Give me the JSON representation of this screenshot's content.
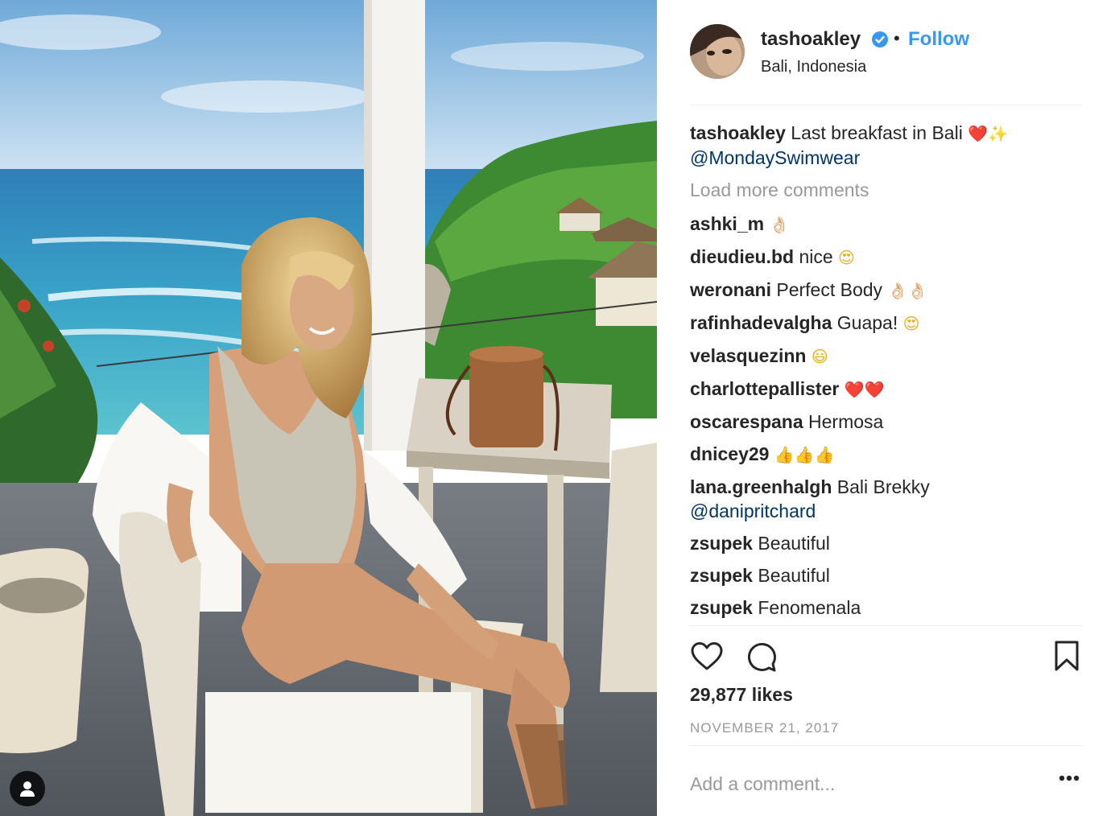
{
  "post": {
    "username": "tashoakley",
    "follow_label": "Follow",
    "separator": "•",
    "location": "Bali, Indonesia",
    "caption": {
      "user": "tashoakley",
      "text": "Last breakfast in Bali",
      "emoji": "❤️✨",
      "mention": "@MondaySwimwear"
    },
    "load_more_label": "Load more comments",
    "comments": [
      {
        "user": "ashki_m",
        "text": "",
        "emoji": "👌🏻"
      },
      {
        "user": "dieudieu.bd",
        "text": "nice",
        "emoji": "😍"
      },
      {
        "user": "weronani",
        "text": "Perfect Body",
        "emoji": "👌🏻👌🏻"
      },
      {
        "user": "rafinhadevalgha",
        "text": "Guapa!",
        "emoji": "😍"
      },
      {
        "user": "velasquezinn",
        "text": "",
        "emoji": "😃"
      },
      {
        "user": "charlottepallister",
        "text": "",
        "emoji": "❤️❤️"
      },
      {
        "user": "oscarespana",
        "text": "Hermosa",
        "emoji": ""
      },
      {
        "user": "dnicey29",
        "text": "",
        "emoji": "👍👍👍"
      },
      {
        "user": "lana.greenhalgh",
        "text": "Bali Brekky",
        "mention": "@danipritchard"
      },
      {
        "user": "zsupek",
        "text": "Beautiful"
      },
      {
        "user": "zsupek",
        "text": "Beautiful"
      },
      {
        "user": "zsupek",
        "text": "Fenomenala"
      }
    ],
    "likes": "29,877 likes",
    "date": "NOVEMBER 21, 2017",
    "add_comment_placeholder": "Add a comment...",
    "icons": {
      "like": "heart-icon",
      "comment": "comment-bubble-icon",
      "save": "bookmark-icon",
      "more": "more-options-icon",
      "verified": "verified-badge-icon",
      "tagged": "user-tag-icon"
    },
    "colors": {
      "link": "#3897f0",
      "mention": "#003569",
      "muted": "#999999",
      "text": "#262626",
      "divider": "#efefef"
    }
  }
}
